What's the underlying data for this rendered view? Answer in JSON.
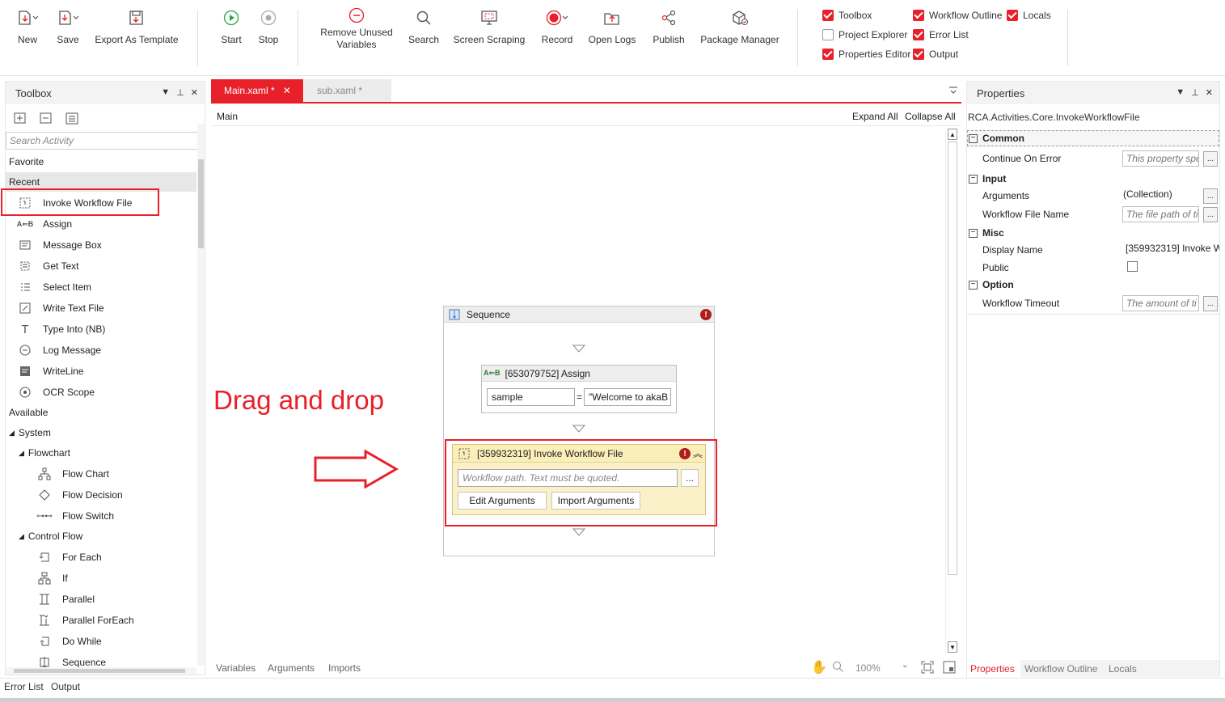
{
  "toolbar": {
    "new": "New",
    "save": "Save",
    "export_template": "Export As Template",
    "start": "Start",
    "stop": "Stop",
    "remove_unused_line1": "Remove Unused",
    "remove_unused_line2": "Variables",
    "search": "Search",
    "screen_scraping": "Screen Scraping",
    "record": "Record",
    "open_logs": "Open Logs",
    "publish": "Publish",
    "package_manager": "Package Manager"
  },
  "view_toggles": {
    "toolbox": "Toolbox",
    "workflow_outline": "Workflow Outline",
    "locals": "Locals",
    "project_explorer": "Project Explorer",
    "error_list": "Error List",
    "properties_editor": "Properties Editor",
    "output": "Output"
  },
  "toolbox": {
    "title": "Toolbox",
    "search_placeholder": "Search Activity",
    "favorite": "Favorite",
    "recent": "Recent",
    "recent_items": [
      "Invoke Workflow File",
      "Assign",
      "Message Box",
      "Get Text",
      "Select Item",
      "Write Text File",
      "Type Into (NB)",
      "Log Message",
      "WriteLine",
      "OCR Scope"
    ],
    "available": "Available",
    "system": "System",
    "flowchart": "Flowchart",
    "flowchart_items": [
      "Flow Chart",
      "Flow Decision",
      "Flow Switch"
    ],
    "control_flow": "Control Flow",
    "control_flow_items": [
      "For Each",
      "If",
      "Parallel",
      "Parallel ForEach",
      "Do While",
      "Sequence"
    ]
  },
  "tabs": {
    "main": "Main.xaml *",
    "sub": "sub.xaml *"
  },
  "designer": {
    "breadcrumb": "Main",
    "expand_all": "Expand All",
    "collapse_all": "Collapse All",
    "sequence_title": "Sequence",
    "assign_title": "[653079752] Assign",
    "assign_to": "sample",
    "assign_eq": "=",
    "assign_value": "\"Welcome to akaB",
    "invoke_title": "[359932319] Invoke Workflow File",
    "invoke_placeholder": "Workflow path. Text must be quoted.",
    "dots": "...",
    "edit_arguments": "Edit Arguments",
    "import_arguments": "Import Arguments",
    "annotation": "Drag and drop",
    "footer_variables": "Variables",
    "footer_arguments": "Arguments",
    "footer_imports": "Imports",
    "zoom": "100%"
  },
  "properties": {
    "title": "Properties",
    "type_name": "RCA.Activities.Core.InvokeWorkflowFile",
    "cat_common": "Common",
    "continue_on_error": "Continue On Error",
    "continue_on_error_ph": "This property spe",
    "cat_input": "Input",
    "arguments": "Arguments",
    "arguments_value": "(Collection)",
    "workflow_file_name": "Workflow File Name",
    "workflow_file_name_ph": "The file path of ti",
    "cat_misc": "Misc",
    "display_name": "Display Name",
    "display_name_value": "[359932319] Invoke W",
    "public": "Public",
    "cat_option": "Option",
    "workflow_timeout": "Workflow Timeout",
    "workflow_timeout_ph": "The amount of ti",
    "dots": "...",
    "tab_properties": "Properties",
    "tab_outline": "Workflow Outline",
    "tab_locals": "Locals"
  },
  "bottom": {
    "error_list": "Error List",
    "output": "Output"
  },
  "colors": {
    "accent": "#e8202a",
    "highlight": "#fbf1c9",
    "annotation": "#e8202a"
  }
}
